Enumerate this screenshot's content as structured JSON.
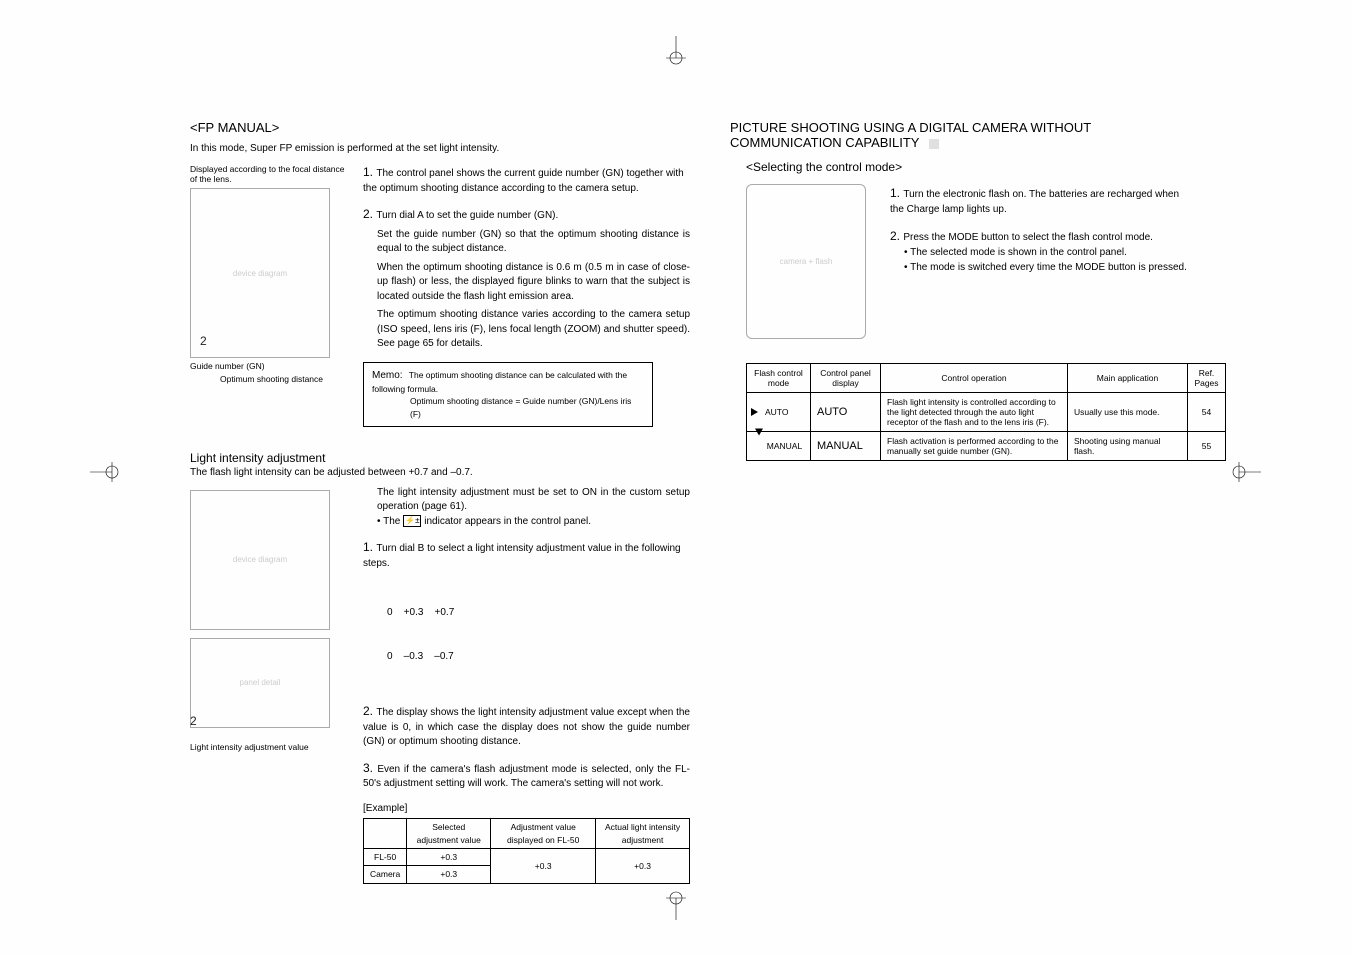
{
  "left": {
    "fp_title": "<FP MANUAL>",
    "fp_intro": "In this mode, Super FP emission is performed at the set light intensity.",
    "img_caption_top": "Displayed according to the focal distance of the lens.",
    "gn_label": "Guide number (GN)",
    "optimum_label": "Optimum shooting distance",
    "callout_2": "2",
    "step1": "The control panel shows the current guide number (GN) together with the optimum shooting distance according to the camera setup.",
    "step2_a": "Turn dial A to set the guide number (GN).",
    "step2_b": "Set the guide number (GN) so that the optimum shooting distance is equal to the subject distance.",
    "step2_c": "When the optimum shooting distance is 0.6 m (0.5 m in case of close-up flash) or less, the displayed figure blinks to warn that the subject is located outside the flash light emission area.",
    "step2_d": "The optimum shooting distance varies according to the camera setup (ISO speed, lens iris (F), lens focal length (ZOOM) and shutter speed). See page 65 for details.",
    "memo_label": "Memo:",
    "memo_line1": "The optimum shooting distance can be calculated with the following formula.",
    "memo_line2": "Optimum shooting distance = Guide number (GN)/Lens iris (F)",
    "light_title": "Light intensity adjustment",
    "light_sub": "The flash light intensity can be adjusted between +0.7 and –0.7.",
    "li_text1": "The light intensity adjustment must be set to ON in the custom setup operation (page 61).",
    "li_text2_prefix": "• The ",
    "li_text2_suffix": " indicator appears in the control panel.",
    "li_step1": "Turn dial B to select a light intensity adjustment value in the following steps.",
    "steps_row1": "0    +0.3    +0.7",
    "steps_row2": "0    –0.3    –0.7",
    "li_step2": "The display shows the light intensity adjustment value except when the value is 0, in which case the display does not show the guide number (GN) or optimum shooting distance.",
    "li_step3": "Even if the camera's flash adjustment mode is selected, only the FL-50's adjustment setting will work. The camera's setting will not work.",
    "light_adj_caption": "Light intensity adjustment value",
    "callout_2b": "2",
    "example_label": "[Example]",
    "example": {
      "h1": "",
      "h2": "Selected adjustment value",
      "h3": "Adjustment value displayed on FL-50",
      "h4": "Actual light intensity adjustment",
      "r1c1": "FL-50",
      "r1c2": "+0.3",
      "merged_c3": "+0.3",
      "merged_c4": "+0.3",
      "r2c1": "Camera",
      "r2c2": "+0.3"
    }
  },
  "right": {
    "title": "PICTURE SHOOTING USING A DIGITAL CAMERA WITHOUT COMMUNICATION CAPABILITY",
    "sub": "<Selecting the control mode>",
    "step1": "Turn the electronic flash on. The batteries are recharged when the Charge lamp lights up.",
    "step2_a": "Press the MODE button to select the flash control mode.",
    "step2_b": "• The selected mode is shown in the control panel.",
    "step2_c": "• The mode is switched every time the MODE button is pressed.",
    "table": {
      "h1": "Flash control mode",
      "h2": "Control panel display",
      "h3": "Control operation",
      "h4": "Main application",
      "h5": "Ref. Pages",
      "r1c1": "AUTO",
      "r1c2": "AUTO",
      "r1c3": "Flash light intensity is controlled according to the light detected through the auto light receptor of the flash and to the lens iris (F).",
      "r1c4": "Usually use this mode.",
      "r1c5": "54",
      "r2c1": "MANUAL",
      "r2c2": "MANUAL",
      "r2c3": "Flash activation is performed according to the manually set guide number (GN).",
      "r2c4": "Shooting using manual flash.",
      "r2c5": "55"
    }
  }
}
